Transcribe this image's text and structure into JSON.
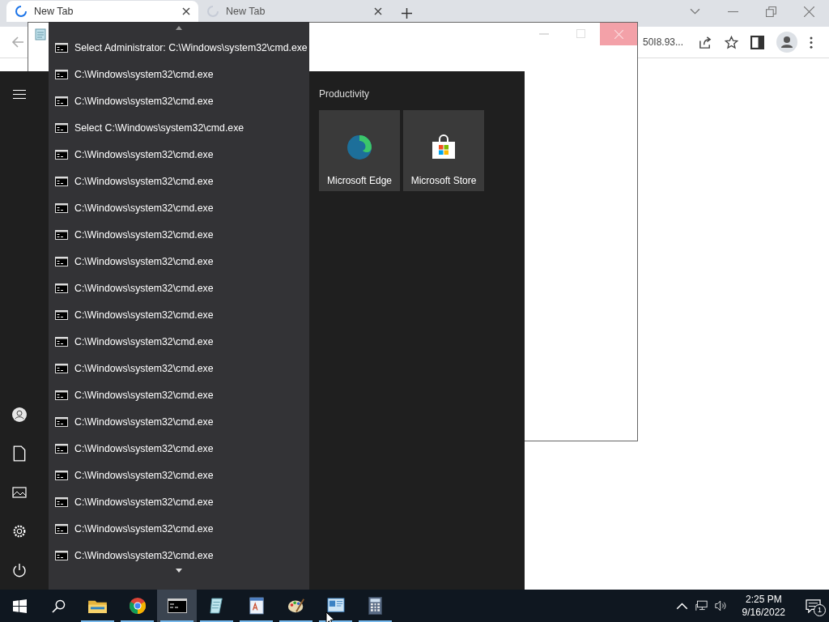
{
  "browser": {
    "tabs": [
      {
        "title": "New Tab",
        "selected": true
      },
      {
        "title": "New Tab",
        "selected": false
      }
    ],
    "address": "50I8.93..."
  },
  "start_menu": {
    "group_title": "Productivity",
    "tiles": [
      {
        "kind": "edge",
        "label": "Microsoft Edge"
      },
      {
        "kind": "store",
        "label": "Microsoft Store"
      }
    ]
  },
  "jump_list": {
    "items": [
      "Select Administrator: C:\\Windows\\system32\\cmd.exe",
      "C:\\Windows\\system32\\cmd.exe",
      "C:\\Windows\\system32\\cmd.exe",
      "Select C:\\Windows\\system32\\cmd.exe",
      "C:\\Windows\\system32\\cmd.exe",
      "C:\\Windows\\system32\\cmd.exe",
      "C:\\Windows\\system32\\cmd.exe",
      "C:\\Windows\\system32\\cmd.exe",
      "C:\\Windows\\system32\\cmd.exe",
      "C:\\Windows\\system32\\cmd.exe",
      "C:\\Windows\\system32\\cmd.exe",
      "C:\\Windows\\system32\\cmd.exe",
      "C:\\Windows\\system32\\cmd.exe",
      "C:\\Windows\\system32\\cmd.exe",
      "C:\\Windows\\system32\\cmd.exe",
      "C:\\Windows\\system32\\cmd.exe",
      "C:\\Windows\\system32\\cmd.exe",
      "C:\\Windows\\system32\\cmd.exe",
      "C:\\Windows\\system32\\cmd.exe",
      "C:\\Windows\\system32\\cmd.exe"
    ]
  },
  "taskbar": {
    "apps": [
      {
        "kind": "explorer",
        "active": false
      },
      {
        "kind": "chrome",
        "active": false
      },
      {
        "kind": "cmd",
        "active": true
      },
      {
        "kind": "notepad",
        "active": false
      },
      {
        "kind": "wordpad",
        "active": false
      },
      {
        "kind": "paint",
        "active": false
      },
      {
        "kind": "panel",
        "active": false
      },
      {
        "kind": "calculator",
        "active": false
      }
    ],
    "time": "2:25 PM",
    "date": "9/16/2022",
    "notifications": "1"
  }
}
